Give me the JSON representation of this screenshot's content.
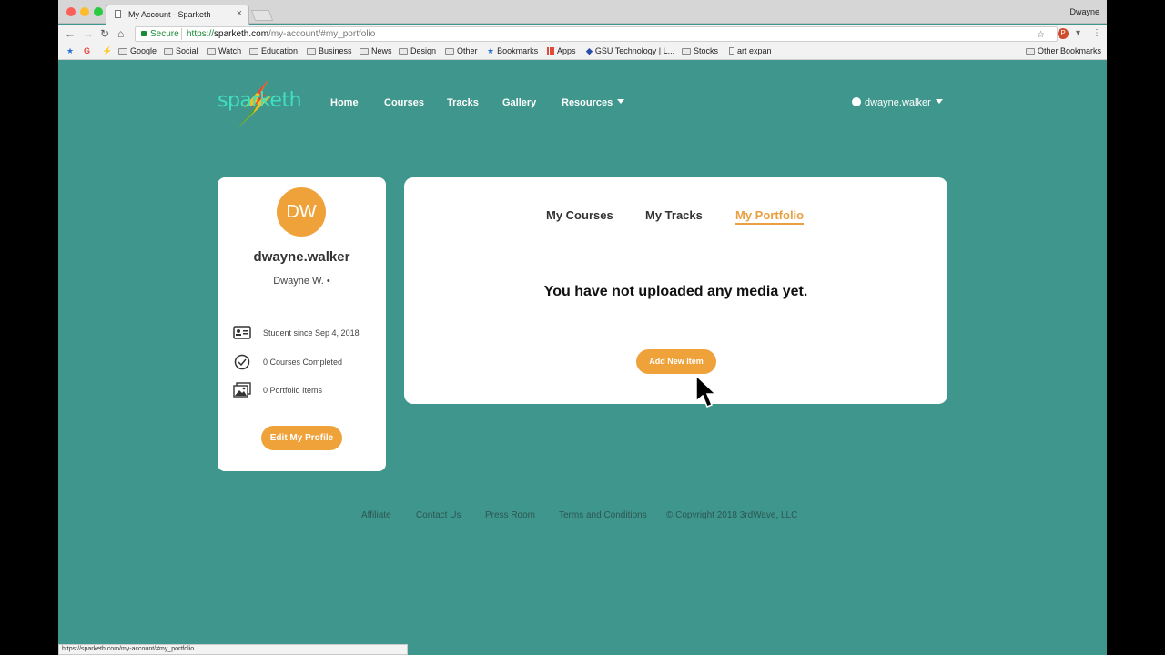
{
  "browser": {
    "tab_title": "My Account - Sparketh",
    "tab_close": "×",
    "profile_name": "Dwayne",
    "secure_label": "Secure",
    "url_scheme": "https://",
    "url_host": "sparketh.com",
    "url_path": "/my-account/#my_portfolio",
    "status_url": "https://sparketh.com/my-account/#my_portfolio"
  },
  "bookmarks": [
    {
      "label": "Google",
      "icon": "folder"
    },
    {
      "label": "Social",
      "icon": "folder"
    },
    {
      "label": "Watch",
      "icon": "folder"
    },
    {
      "label": "Education",
      "icon": "folder"
    },
    {
      "label": "Business",
      "icon": "folder"
    },
    {
      "label": "News",
      "icon": "folder"
    },
    {
      "label": "Design",
      "icon": "folder"
    },
    {
      "label": "Other",
      "icon": "folder"
    },
    {
      "label": "Bookmarks",
      "icon": "star"
    },
    {
      "label": "Apps",
      "icon": "apps"
    },
    {
      "label": "GSU Technology | L...",
      "icon": "site"
    },
    {
      "label": "Stocks",
      "icon": "folder"
    },
    {
      "label": "art expan",
      "icon": "doc"
    },
    {
      "label": "Other Bookmarks",
      "icon": "folder"
    }
  ],
  "site": {
    "logo_text": "sparketh",
    "nav": {
      "home": "Home",
      "courses": "Courses",
      "tracks": "Tracks",
      "gallery": "Gallery",
      "resources": "Resources"
    },
    "user_menu": "dwayne.walker",
    "accent": "#f0a23a",
    "background": "#3f968c"
  },
  "profile": {
    "initials": "DW",
    "username": "dwayne.walker",
    "full_name": "Dwayne W. •",
    "stats": {
      "since": "Student since Sep 4, 2018",
      "courses": "0 Courses Completed",
      "portfolio": "0 Portfolio Items"
    },
    "edit_label": "Edit My Profile"
  },
  "main": {
    "tabs": {
      "courses": "My Courses",
      "tracks": "My Tracks",
      "portfolio": "My Portfolio"
    },
    "active_tab": "My Portfolio",
    "empty_message": "You have not uploaded any media yet.",
    "add_label": "Add New Item"
  },
  "footer": {
    "affiliate": "Affiliate",
    "contact": "Contact Us",
    "press": "Press Room",
    "terms": "Terms and Conditions",
    "copyright": "© Copyright 2018 3rdWave, LLC"
  }
}
